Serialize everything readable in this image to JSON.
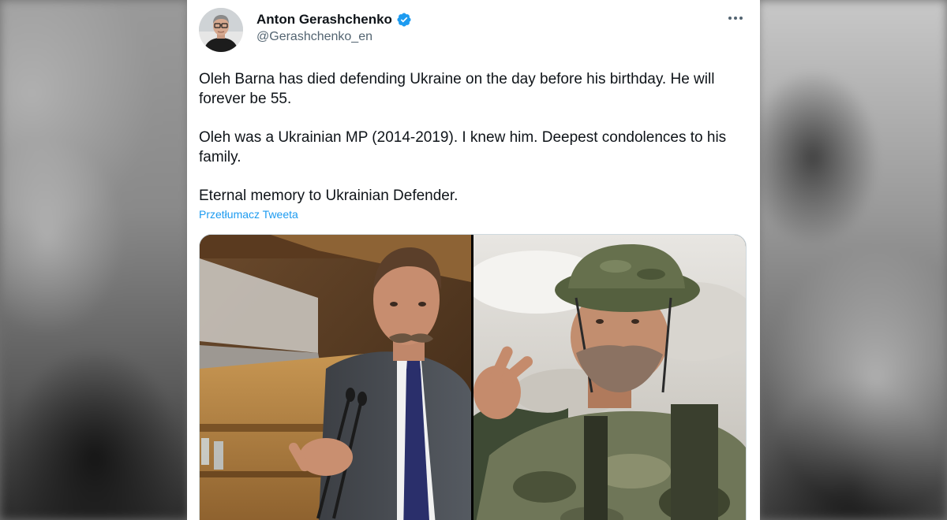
{
  "author": {
    "name": "Anton Gerashchenko",
    "handle": "@Gerashchenko_en",
    "verified_icon": "verified-badge-icon",
    "avatar_icon": "avatar-photo"
  },
  "tweet": {
    "paragraphs": [
      "Oleh Barna has died defending Ukraine on the day before his birthday. He will forever be 55.",
      "Oleh was a Ukrainian MP (2014-2019). I knew him. Deepest condolences to his family.",
      "Eternal memory to Ukrainian Defender."
    ],
    "translate_link": "Przetłumacz Tweeta"
  },
  "media": {
    "count": 2,
    "images": [
      "photo-parliament",
      "photo-soldier"
    ]
  },
  "colors": {
    "link": "#1d9bf0",
    "text": "#0f1419",
    "secondary": "#536471",
    "verified": "#1d9bf0"
  }
}
